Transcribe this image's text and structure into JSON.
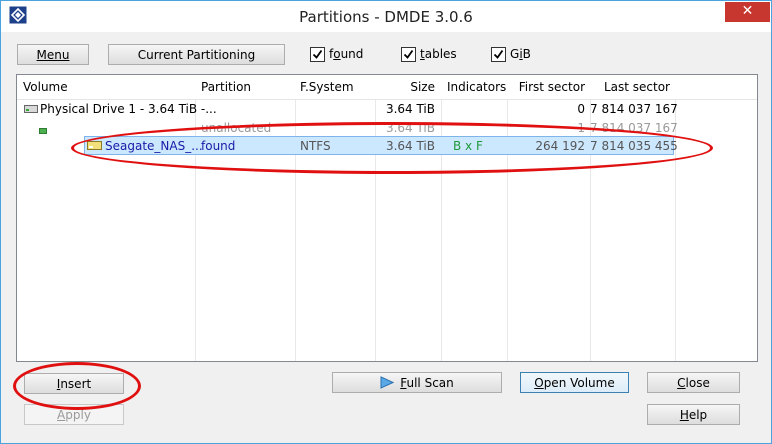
{
  "window": {
    "title": "Partitions - DMDE 3.0.6",
    "close_glyph": "✕"
  },
  "toolbar": {
    "menu_label": "Menu",
    "current_partitioning_label": "Current Partitioning",
    "checkboxes": [
      {
        "pre": "f",
        "ul": "o",
        "post": "und",
        "checked": true
      },
      {
        "pre": "",
        "ul": "t",
        "post": "ables",
        "checked": true
      },
      {
        "pre": "G",
        "ul": "i",
        "post": "B",
        "checked": true
      }
    ]
  },
  "columns": [
    "Volume",
    "Partition",
    "F.System",
    "Size",
    "Indicators",
    "First sector",
    "Last sector"
  ],
  "rows": [
    {
      "volume": "Physical Drive 1 - 3.64 TiB -...",
      "partition": "",
      "fsystem": "",
      "size": "3.64 TiB",
      "indicators": "",
      "first_sector": "0",
      "last_sector": "7 814 037 167",
      "icon": "hard-drive-icon"
    },
    {
      "volume": "",
      "partition": "unallocated",
      "fsystem": "",
      "size": "3.64 TiB",
      "indicators": "",
      "first_sector": "1",
      "last_sector": "7 814 037 167",
      "icon": "unallocated-icon"
    },
    {
      "volume": "Seagate_NAS_...",
      "partition": "found",
      "fsystem": "NTFS",
      "size": "3.64 TiB",
      "indicators": "B x F",
      "first_sector": "264 192",
      "last_sector": "7 814 035 455",
      "icon": "volume-icon",
      "selected": true
    }
  ],
  "buttons": {
    "insert": {
      "pre": "",
      "ul": "I",
      "post": "nsert"
    },
    "apply": {
      "pre": "",
      "ul": "A",
      "post": "pply"
    },
    "full_scan": {
      "pre": "",
      "ul": "F",
      "post": "ull Scan"
    },
    "open_volume": {
      "pre": "",
      "ul": "O",
      "post": "pen Volume"
    },
    "close": {
      "pre": "",
      "ul": "C",
      "post": "lose"
    },
    "help": {
      "pre": "",
      "ul": "H",
      "post": "elp"
    }
  },
  "colors": {
    "accent": "#4aa3df",
    "selection": "#cce8ff",
    "highlight_red": "#e01010",
    "link_blue": "#1a1aa6",
    "indicator_green": "#1e9a3a"
  }
}
